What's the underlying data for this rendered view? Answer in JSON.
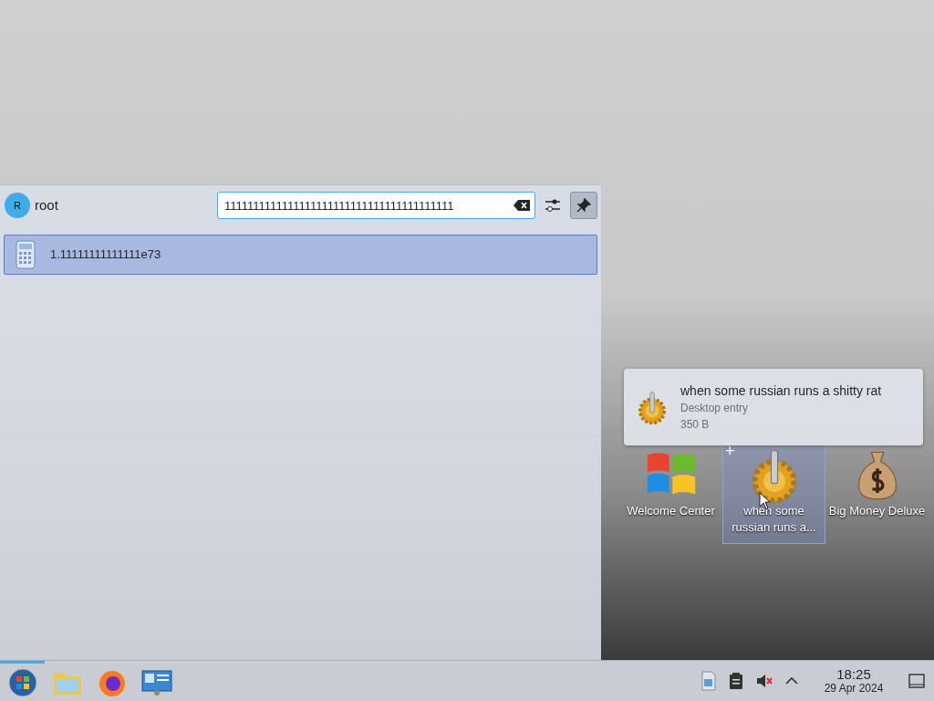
{
  "launcher": {
    "user": {
      "initial": "R",
      "name": "root"
    },
    "search": {
      "value": "1111111111111111111111111111111111111111"
    },
    "pinned": true,
    "results": [
      {
        "label": "1.11111111111111e73",
        "selected": true
      }
    ]
  },
  "select_toggle": "+",
  "desktop_icons": [
    {
      "label": "Welcome Center",
      "kind": "windows",
      "selected": false
    },
    {
      "label": "when some russian runs a...",
      "kind": "gear",
      "selected": true
    },
    {
      "label": "Big Money Deluxe",
      "kind": "moneybag",
      "selected": false
    }
  ],
  "tooltip": {
    "title": "when some russian runs a shitty rat",
    "type": "Desktop entry",
    "size": "350 B"
  },
  "taskbar": {
    "apps": [
      {
        "kind": "start",
        "active": true
      },
      {
        "kind": "folder",
        "active": false
      },
      {
        "kind": "browser",
        "active": false
      },
      {
        "kind": "monitor",
        "active": false
      }
    ],
    "tray": [
      {
        "kind": "document"
      },
      {
        "kind": "clipboard"
      },
      {
        "kind": "muted"
      },
      {
        "kind": "expand"
      }
    ],
    "clock": {
      "time": "18:25",
      "date": "29 Apr 2024"
    }
  }
}
